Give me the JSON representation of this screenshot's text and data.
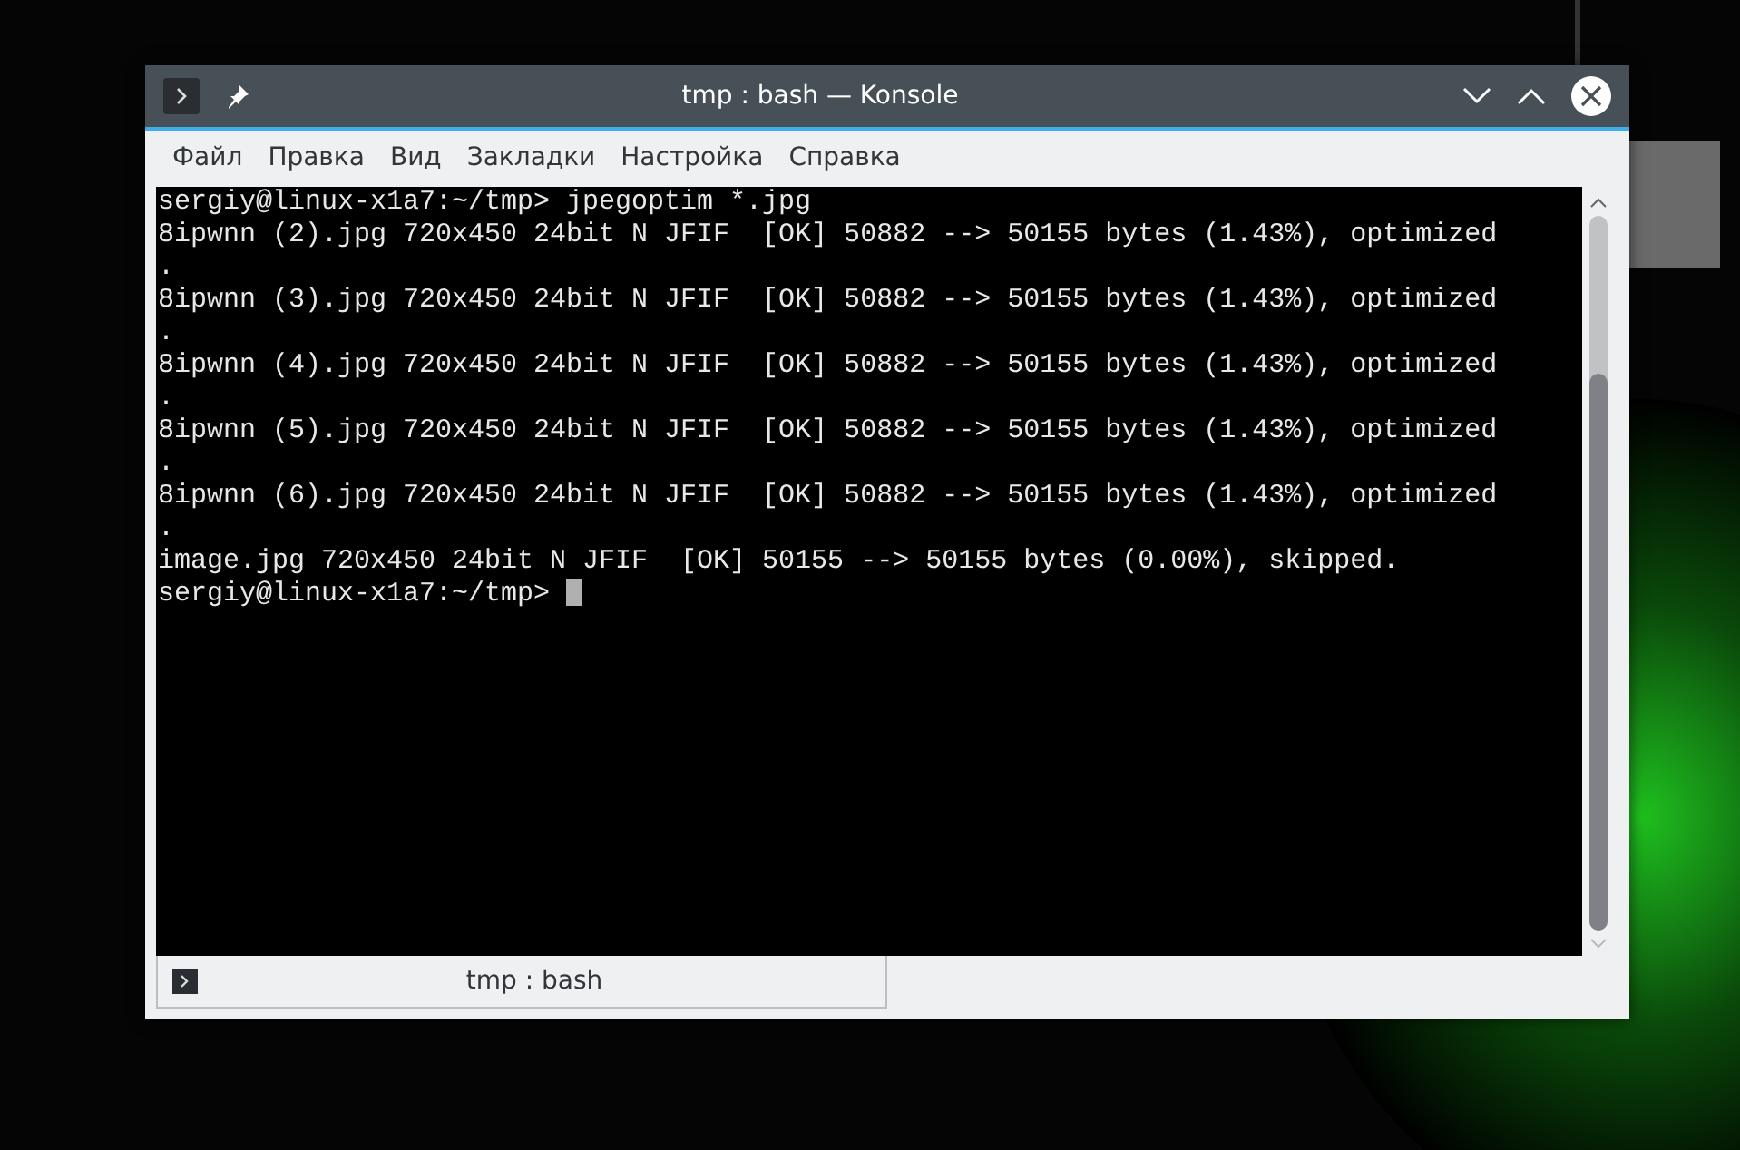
{
  "window": {
    "title": "tmp : bash — Konsole"
  },
  "menu": [
    "Файл",
    "Правка",
    "Вид",
    "Закладки",
    "Настройка",
    "Справка"
  ],
  "terminal": {
    "lines": [
      "sergiy@linux-x1a7:~/tmp> jpegoptim *.jpg",
      "8ipwnn (2).jpg 720x450 24bit N JFIF  [OK] 50882 --> 50155 bytes (1.43%), optimized",
      ".",
      "8ipwnn (3).jpg 720x450 24bit N JFIF  [OK] 50882 --> 50155 bytes (1.43%), optimized",
      ".",
      "8ipwnn (4).jpg 720x450 24bit N JFIF  [OK] 50882 --> 50155 bytes (1.43%), optimized",
      ".",
      "8ipwnn (5).jpg 720x450 24bit N JFIF  [OK] 50882 --> 50155 bytes (1.43%), optimized",
      ".",
      "8ipwnn (6).jpg 720x450 24bit N JFIF  [OK] 50882 --> 50155 bytes (1.43%), optimized",
      ".",
      "image.jpg 720x450 24bit N JFIF  [OK] 50155 --> 50155 bytes (0.00%), skipped.",
      "sergiy@linux-x1a7:~/tmp> "
    ],
    "cursor": true
  },
  "tabs": [
    {
      "label": "tmp : bash",
      "selected": true
    }
  ]
}
